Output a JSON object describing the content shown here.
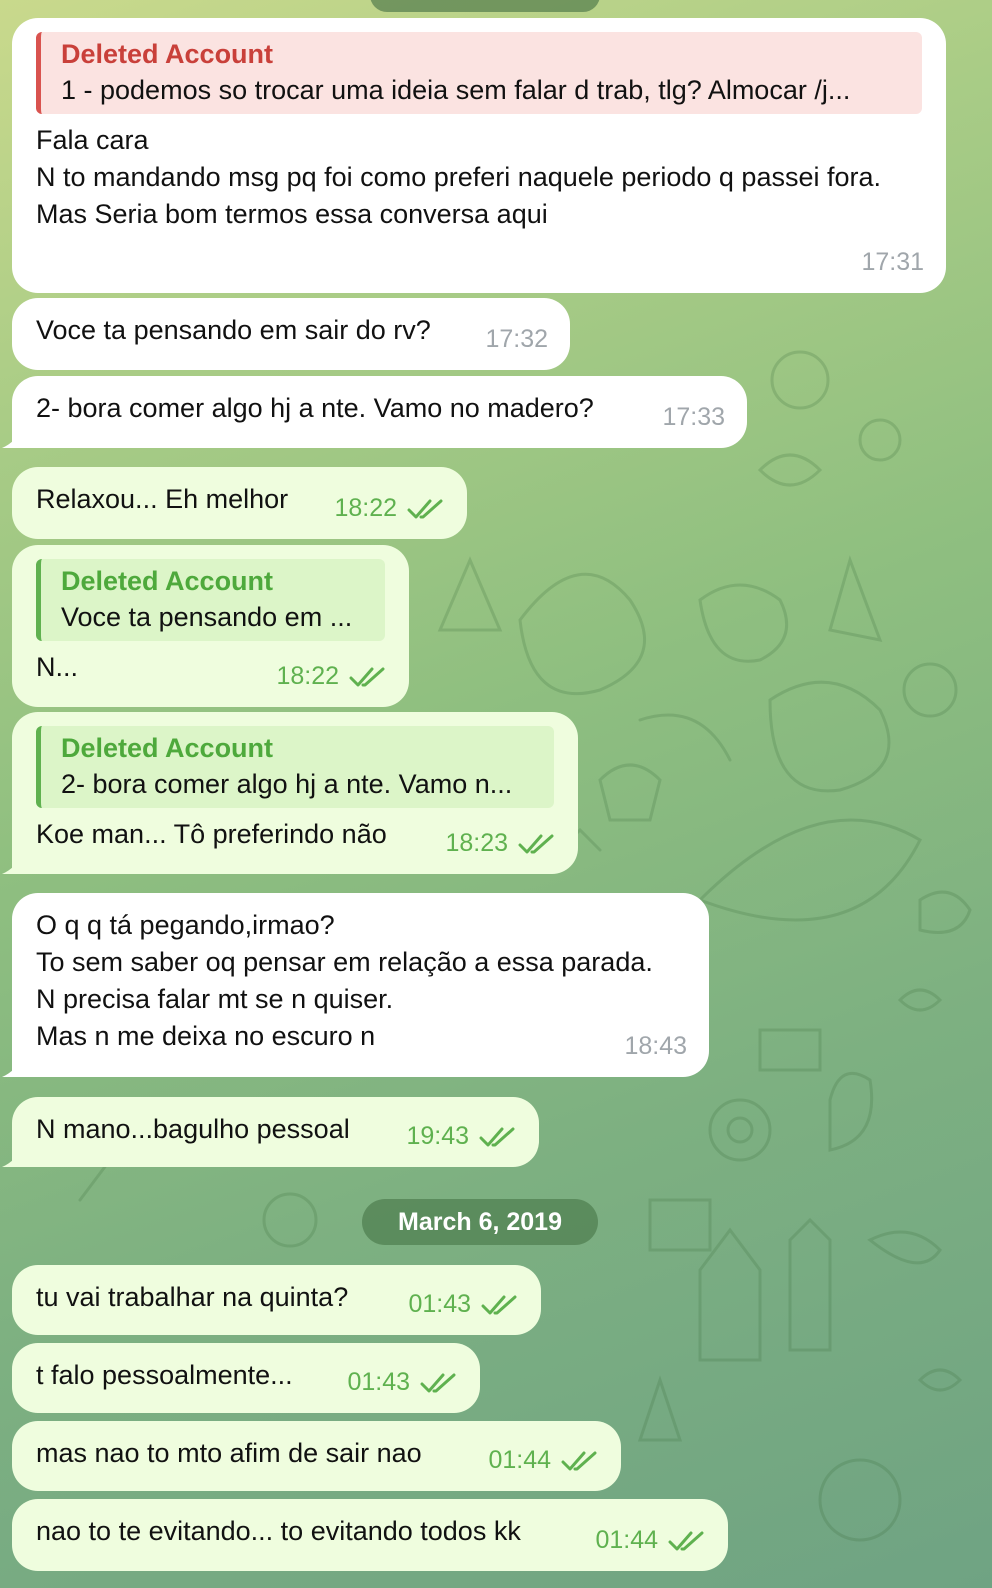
{
  "date_separator": "March 6, 2019",
  "messages": [
    {
      "reply": {
        "name": "Deleted Account",
        "text": "1 - podemos so trocar uma ideia sem falar d trab, tlg? Almocar /j..."
      },
      "text": "Fala cara\nN to mandando msg pq foi como preferi naquele periodo q passei fora.\nMas Seria bom termos essa conversa aqui",
      "time": "17:31"
    },
    {
      "text": "Voce ta pensando em sair do rv?",
      "time": "17:32"
    },
    {
      "text": "2- bora comer algo hj a nte. Vamo no madero?",
      "time": "17:33"
    },
    {
      "text": "Relaxou... Eh melhor",
      "time": "18:22"
    },
    {
      "reply": {
        "name": "Deleted Account",
        "text": "Voce ta pensando em ..."
      },
      "text": "N...",
      "time": "18:22"
    },
    {
      "reply": {
        "name": "Deleted Account",
        "text": "2- bora comer algo hj a nte. Vamo n..."
      },
      "text": "Koe man... Tô preferindo não",
      "time": "18:23"
    },
    {
      "text": "O q q tá pegando,irmao?\nTo sem saber oq pensar em relação a essa parada.\nN precisa falar mt se n quiser.\nMas n me deixa no escuro n",
      "time": "18:43"
    },
    {
      "text": "N mano...bagulho pessoal",
      "time": "19:43"
    },
    {
      "text": "tu vai trabalhar na quinta?",
      "time": "01:43"
    },
    {
      "text": "t falo pessoalmente...",
      "time": "01:43"
    },
    {
      "text": "mas nao to mto afim de sair nao",
      "time": "01:44"
    },
    {
      "text": "nao to te evitando... to evitando todos kk",
      "time": "01:44"
    }
  ],
  "colors": {
    "incoming_bubble": "#ffffff",
    "outgoing_bubble": "#effdde",
    "read_check": "#5fb14f",
    "reply_red": "#c9403a",
    "reply_green": "#4ea93c"
  },
  "icons": {
    "read_receipt": "double-check-icon"
  }
}
